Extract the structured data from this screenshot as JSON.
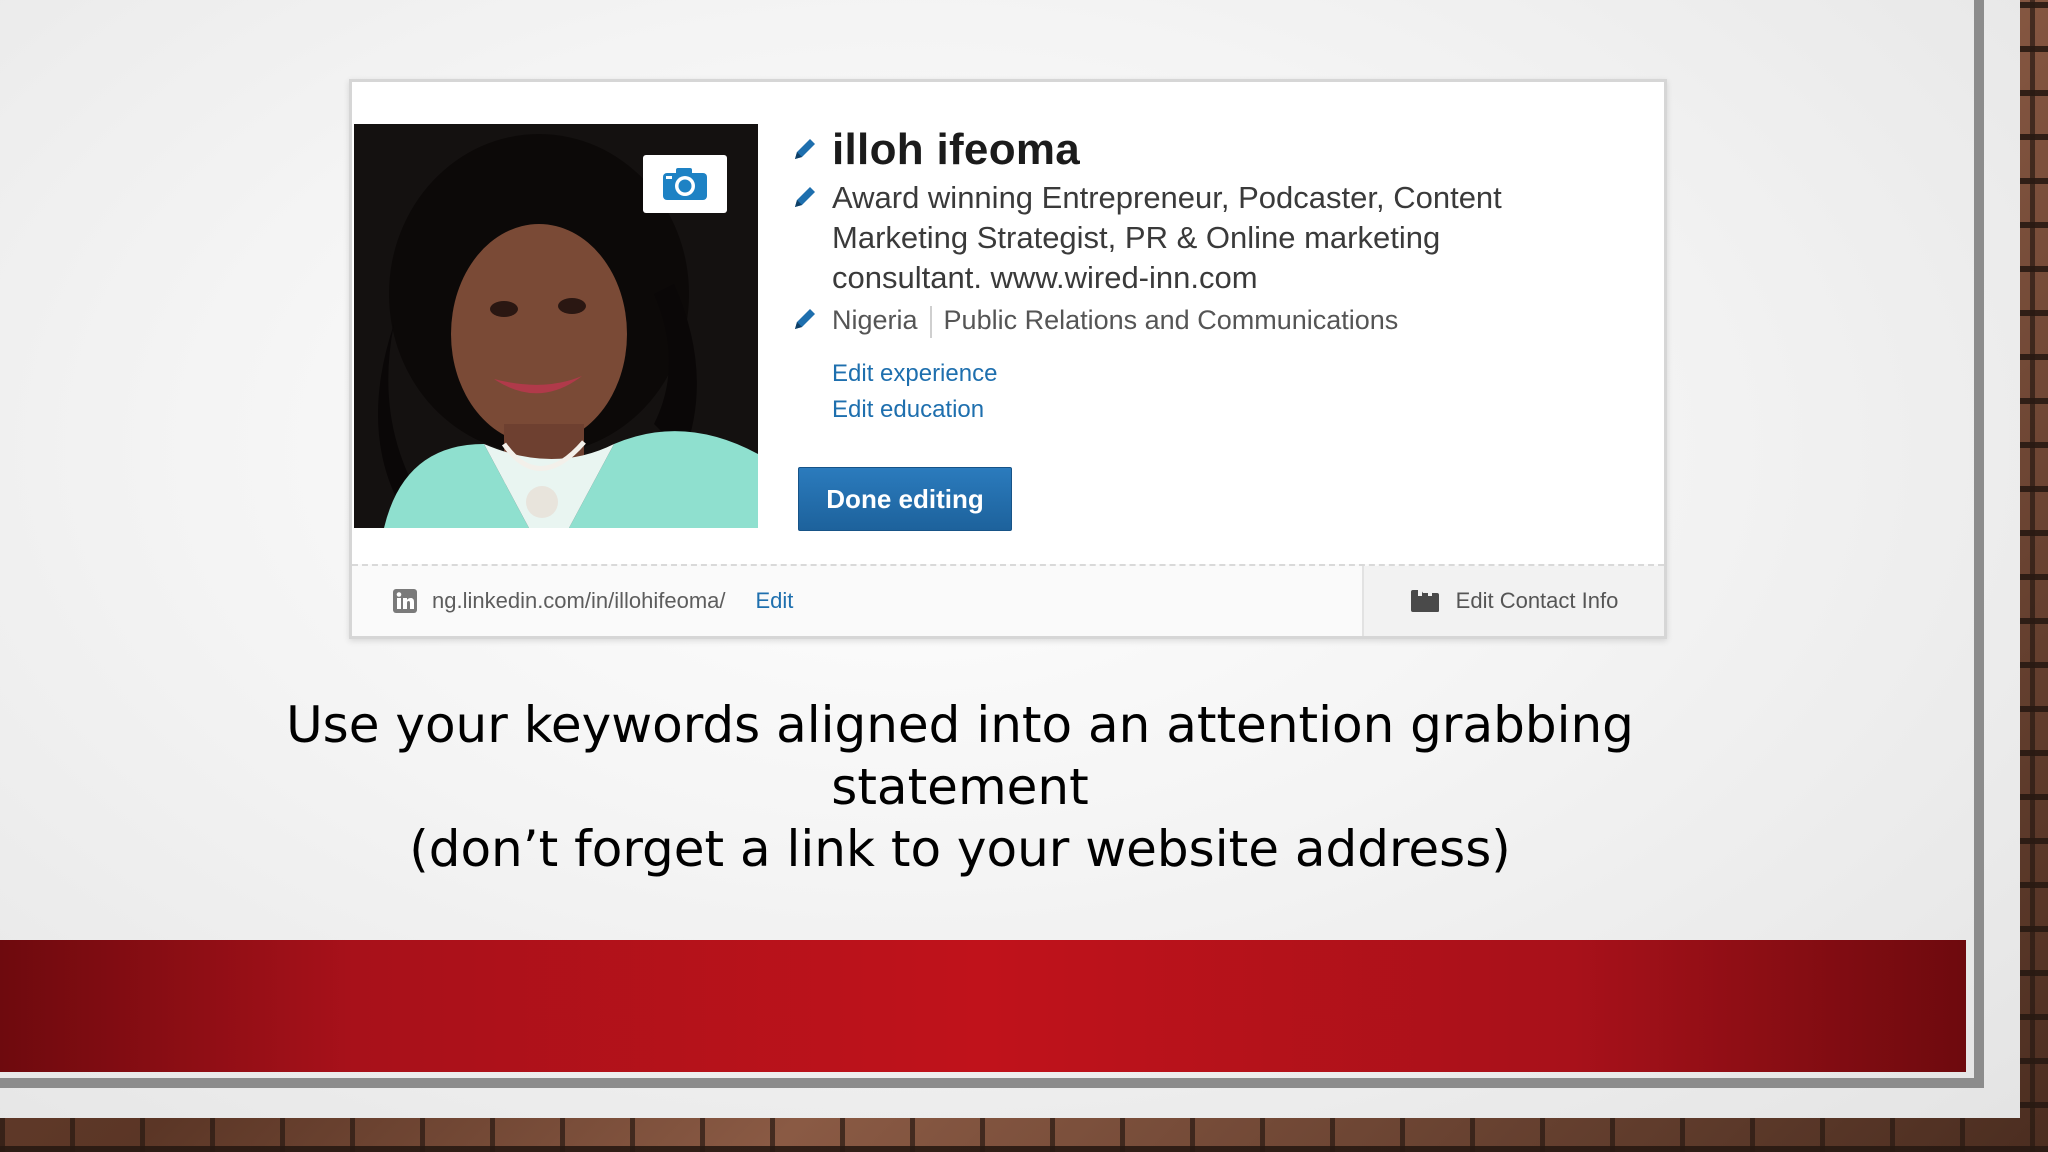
{
  "profile": {
    "name": "illoh ifeoma",
    "headline_lines": [
      "Award winning Entrepreneur, Podcaster, Content",
      "Marketing Strategist, PR & Online marketing",
      "consultant. www.wired-inn.com"
    ],
    "location": "Nigeria",
    "industry": "Public Relations and Communications",
    "edit_experience": "Edit experience",
    "edit_education": "Edit education",
    "done_button": "Done editing",
    "profile_url": "ng.linkedin.com/in/illohifeoma/",
    "url_edit": "Edit",
    "edit_contact": "Edit Contact Info"
  },
  "caption": {
    "line1": "Use your keywords aligned into an attention grabbing statement",
    "line2": "(don’t forget a link to your website address)"
  },
  "colors": {
    "accent_blue": "#1e6fae",
    "band_red": "#c0121b"
  }
}
